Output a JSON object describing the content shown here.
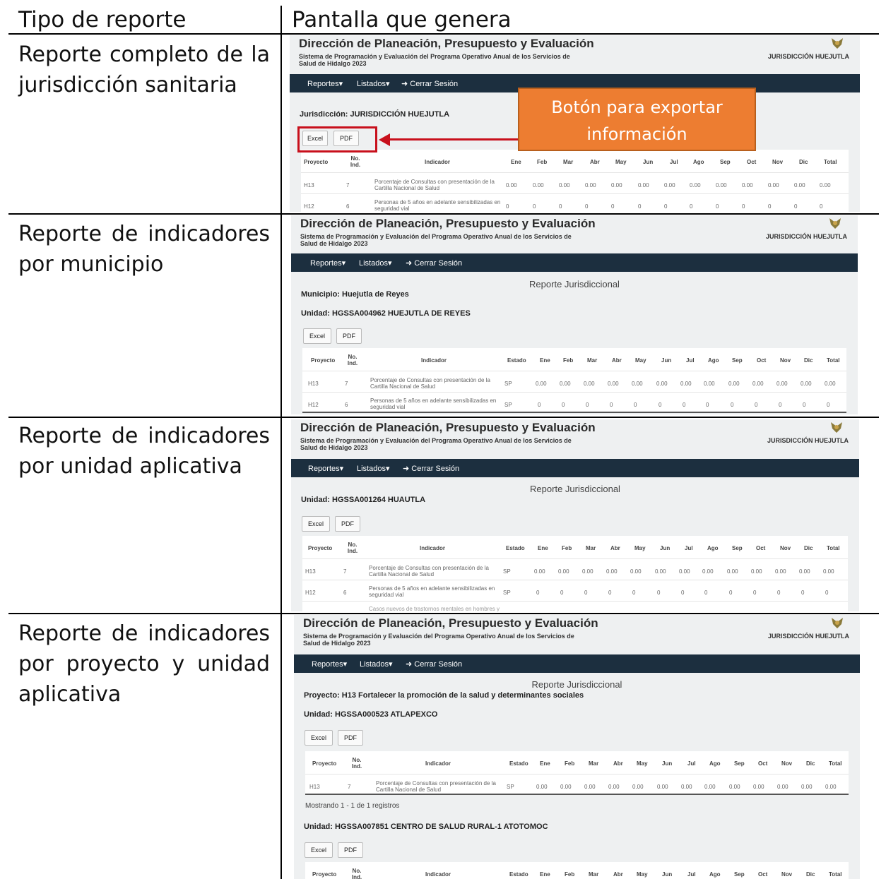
{
  "headers": {
    "left": "Tipo de reporte",
    "right": "Pantalla que genera"
  },
  "rows": [
    {
      "type": "Reporte completo de la jurisdicción sanitaria"
    },
    {
      "type": "Reporte de indicadores por municipio"
    },
    {
      "type": "Reporte de indicadores por unidad aplicativa"
    },
    {
      "type": "Reporte de indicadores por proyecto y unidad aplicativa"
    }
  ],
  "app": {
    "title": "Dirección de Planeación, Presupuesto y Evaluación",
    "subtitle": "Sistema de Programación y Evaluación del Programa Operativo Anual de los Servicios de Salud de Hidalgo 2023",
    "jurisdiction": "JURISDICCIÓN HUEJUTLA",
    "nav": {
      "reportes": "Reportes▾",
      "listados": "Listados▾",
      "logout": "➜ Cerrar Sesión"
    },
    "report_title": "Reporte Jurisdiccional",
    "excel": "Excel",
    "pdf": "PDF"
  },
  "callout": "Botón para exportar información",
  "panel1": {
    "label": "Jurisdicción: JURISDICCIÓN HUEJUTLA"
  },
  "panel2": {
    "municipio": "Municipio: Huejutla de Reyes",
    "unidad": "Unidad: HGSSA004962 HUEJUTLA DE REYES"
  },
  "panel3": {
    "unidad": "Unidad: HGSSA001264 HUAUTLA",
    "extra": "Casos nuevos de trastornos mentales en hombres y"
  },
  "panel4": {
    "proyecto": "Proyecto: H13 Fortalecer la promoción de la salud y determinantes sociales",
    "unidad1": "Unidad: HGSSA000523 ATLAPEXCO",
    "showing": "Mostrando 1 - 1 de 1 registros",
    "unidad2": "Unidad: HGSSA007851 CENTRO DE SALUD RURAL-1 ATOTOMOC"
  },
  "table": {
    "cols": {
      "proyecto": "Proyecto",
      "no": "No. Ind.",
      "indicador": "Indicador",
      "estado": "Estado"
    },
    "months": [
      "Ene",
      "Feb",
      "Mar",
      "Abr",
      "May",
      "Jun",
      "Jul",
      "Ago",
      "Sep",
      "Oct",
      "Nov",
      "Dic",
      "Total"
    ],
    "r1": {
      "proyecto": "H13",
      "no": "7",
      "indicador": "Porcentaje de Consultas con presentación de la Cartilla Nacional de Salud",
      "estado": "SP",
      "val": "0.00"
    },
    "r2": {
      "proyecto": "H12",
      "no": "6",
      "indicador": "Personas de 5 años en adelante sensibilizadas en seguridad vial",
      "estado": "SP",
      "val": "0"
    }
  }
}
